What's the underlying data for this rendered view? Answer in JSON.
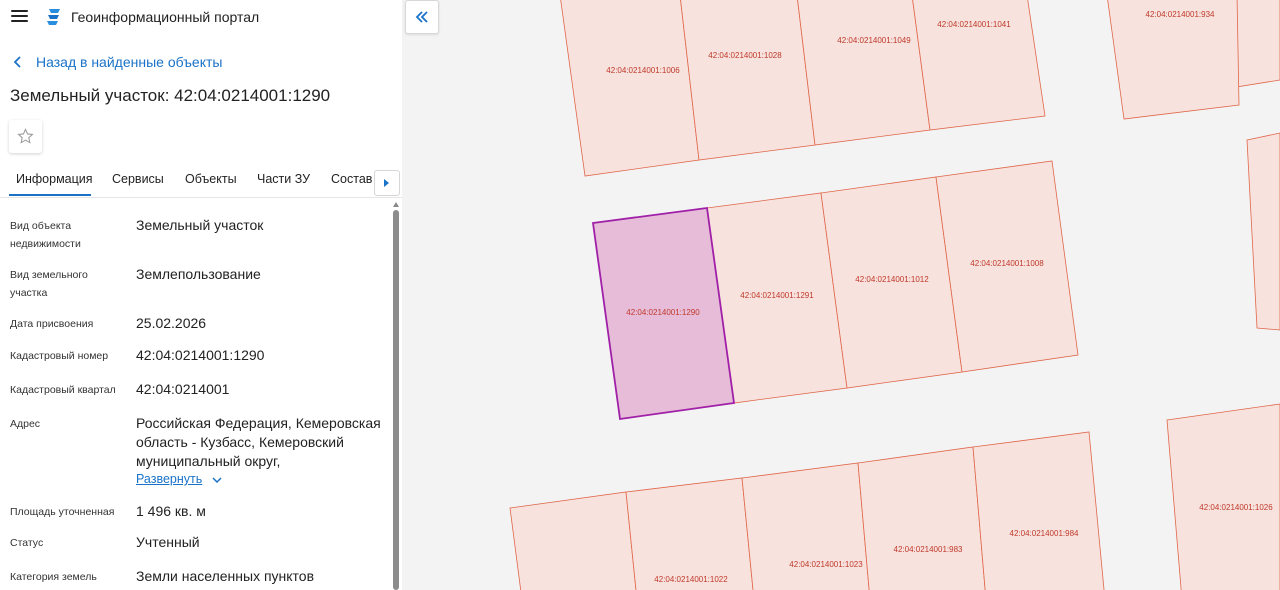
{
  "header": {
    "app_title": "Геоинформационный портал"
  },
  "nav": {
    "back_label": "Назад в найденные объекты"
  },
  "object": {
    "title": "Земельный участок: 42:04:0214001:1290"
  },
  "tabs": [
    {
      "label": "Информация"
    },
    {
      "label": "Сервисы"
    },
    {
      "label": "Объекты"
    },
    {
      "label": "Части ЗУ"
    },
    {
      "label": "Состав"
    }
  ],
  "info": {
    "rows": [
      {
        "label": "Вид объекта недвижимости",
        "value": "Земельный участок"
      },
      {
        "label": "Вид земельного участка",
        "value": "Землепользование"
      },
      {
        "label": "Дата присвоения",
        "value": "25.02.2026"
      },
      {
        "label": "Кадастровый номер",
        "value": "42:04:0214001:1290"
      },
      {
        "label": "Кадастровый квартал",
        "value": "42:04:0214001"
      },
      {
        "label": "Адрес",
        "value": "Российская Федерация, Кемеровская область - Кузбасс, Кемеровский муниципальный округ,"
      },
      {
        "label": "Площадь уточненная",
        "value": "1 496 кв. м"
      },
      {
        "label": "Статус",
        "value": "Учтенный"
      },
      {
        "label": "Категория земель",
        "value": "Земли населенных пунктов"
      }
    ],
    "expand_label": "Развернуть"
  },
  "map": {
    "parcels": [
      {
        "id": "42:04:0214001:1006"
      },
      {
        "id": "42:04:0214001:1028"
      },
      {
        "id": "42:04:0214001:1049"
      },
      {
        "id": "42:04:0214001:1041"
      },
      {
        "id": "42:04:0214001:934"
      },
      {
        "id": "42:04:0214001:1290"
      },
      {
        "id": "42:04:0214001:1291"
      },
      {
        "id": "42:04:0214001:1012"
      },
      {
        "id": "42:04:0214001:1008"
      },
      {
        "id": "42:04:0214001:1022"
      },
      {
        "id": "42:04:0214001:1023"
      },
      {
        "id": "42:04:0214001:983"
      },
      {
        "id": "42:04:0214001:984"
      },
      {
        "id": "42:04:0214001:1026"
      }
    ],
    "colors": {
      "parcel_fill": "#f7e2dd",
      "parcel_stroke": "#e0664a",
      "selected_fill": "#e6bcd8",
      "selected_stroke": "#a020a8",
      "label": "#c0392b"
    }
  }
}
